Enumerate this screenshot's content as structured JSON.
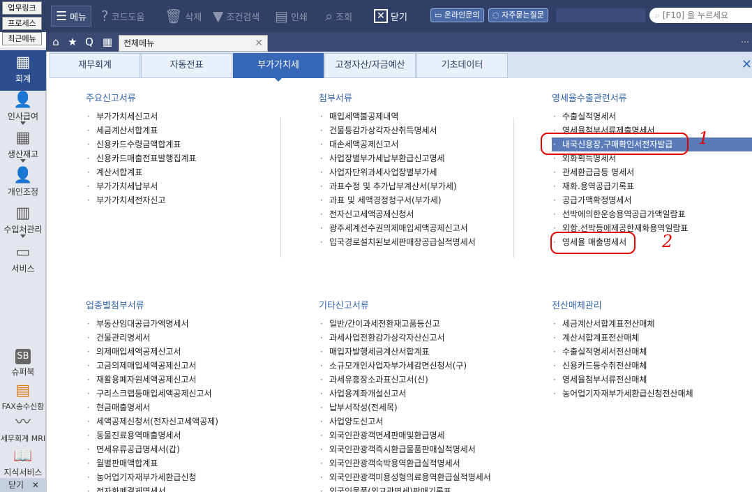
{
  "toolbar": {
    "quicklinks": [
      "업무링크",
      "프로세스",
      "최근메뉴"
    ],
    "menu_label": "메뉴",
    "code_help": "코드도움",
    "delete": "삭제",
    "cond_search": "조건검색",
    "print": "인쇄",
    "view": "조회",
    "close": "닫기",
    "online_inquiry": "온라인문의",
    "faq": "자주묻는질문",
    "search_placeholder": "[F10] 을 누르세요"
  },
  "nav": {
    "doc_tab_label": "전체메뉴"
  },
  "sidebar": {
    "items": [
      "회계",
      "인사급여",
      "생산재고",
      "개인조정",
      "수입처관리",
      "서비스",
      "슈퍼북",
      "FAX송수신함",
      "세무회계 MRI",
      "지식서비스"
    ],
    "close_label": "닫기"
  },
  "tabs": [
    "재무회계",
    "자동전표",
    "부가가치세",
    "고정자산/자금예산",
    "기초데이터"
  ],
  "active_tab": "부가가치세",
  "sections": {
    "main_returns": {
      "title": "주요신고서류",
      "items": [
        "부가가치세신고서",
        "세금계산서합계표",
        "신용카드수령금액합계표",
        "신용카드매출전표발행집계표",
        "계산서합계표",
        "부가가치세납부서",
        "부가가치세전자신고"
      ]
    },
    "attachments": {
      "title": "첨부서류",
      "items": [
        "매입세액불공제내역",
        "건물등감가상각자산취득명세서",
        "대손세액공제신고서",
        "사업장별부가세납부환급신고명세",
        "사업자단위과세사업장별부가세",
        "과표수정 및 추가납부계산서(부가세)",
        "과표 및 세액경정청구서(부가세)",
        "전자신고세액공제신청서",
        "광주세계선수권의제매입세액공제신고서",
        "입국경로설치된보세판매장공급실적명세서"
      ]
    },
    "zero_rate": {
      "title": "영세율수출관련서류",
      "items": [
        "수출실적명세서",
        "영세율첨부서류제출명세서",
        "내국신용장,구매확인서전자발급",
        "외화획득명세서",
        "관세환급금등 명세서",
        "재화.용역공급기록표",
        "공급가액확정명세서",
        "선박에의한운송용역공급가액일람표",
        "외항.선박등에제공한재화용역일람표",
        "영세율 매출명세서"
      ]
    },
    "industry": {
      "title": "업종별첨부서류",
      "items": [
        "부동산임대공급가액명세서",
        "건물관리명세서",
        "의제매입세액공제신고서",
        "고금의제매입세액공제신고서",
        "재활용폐자원세액공제신고서",
        "구리스크랩등매입세액공제신고서",
        "현금매출명세서",
        "세액공제신청서(전자신고세액공제)",
        "동물진료용역매출명세서",
        "면세유류공급명세서(갑)",
        "월별판매액합계표",
        "농어업기자재부가세환급신청",
        "전자화폐결제명세서"
      ]
    },
    "other": {
      "title": "기타신고서류",
      "items": [
        "일반/간이과세전환재고품등신고",
        "과세사업전환감가상각자산신고서",
        "매입자발행세금계산서합계표",
        "소규모개인사업자부가세감면신청서(구)",
        "과세유흥장소과표신고서(신)",
        "사업용계좌개설신고서",
        "납부서작성(전세목)",
        "사업양도신고서",
        "외국인관광객면세판매및환급명세",
        "외국인관광객즉시환급물품판매실적명세서",
        "외국인관광객숙박용역환급실적명세서",
        "외국인관광객미용성형의료용역환급실적명세서",
        "외국인물품(외교관면세)판매기록표"
      ]
    },
    "media": {
      "title": "전산매체관리",
      "items": [
        "세금계산서합계표전산매체",
        "계산서합계표전산매체",
        "수출실적명세서전산매체",
        "신용카드등수취전산매체",
        "영세율첨부서류전산매체",
        "농어업기자재부가세환급신청전산매체"
      ]
    }
  },
  "annotations": [
    "1",
    "2"
  ],
  "colors": {
    "toolbar_bg": "#2f3f66",
    "active_tab": "#3768b8",
    "highlight_row": "#5a7bb8",
    "section_title": "#3466ad",
    "annotation": "#e00000"
  }
}
